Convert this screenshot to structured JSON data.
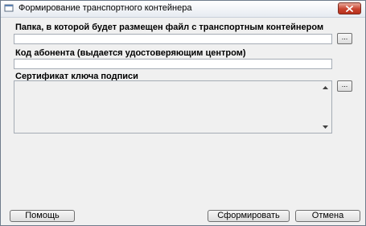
{
  "window": {
    "title": "Формирование транспортного контейнера"
  },
  "form": {
    "folder_label": "Папка, в которой будет размещен файл с транспортным контейнером",
    "folder_value": "",
    "folder_browse_label": "...",
    "subscriber_code_label": "Код абонента (выдается удостоверяющим центром)",
    "subscriber_code_value": "",
    "certificate_label": "Сертификат ключа подписи",
    "certificate_browse_label": "..."
  },
  "buttons": {
    "help": "Помощь",
    "generate": "Сформировать",
    "cancel": "Отмена"
  },
  "icons": {
    "app": "app-window-icon",
    "close": "close-icon",
    "scroll_up": "scroll-up-icon",
    "scroll_down": "scroll-down-icon"
  },
  "colors": {
    "close_button": "#c8432f",
    "window_background": "#f0f0f0"
  }
}
